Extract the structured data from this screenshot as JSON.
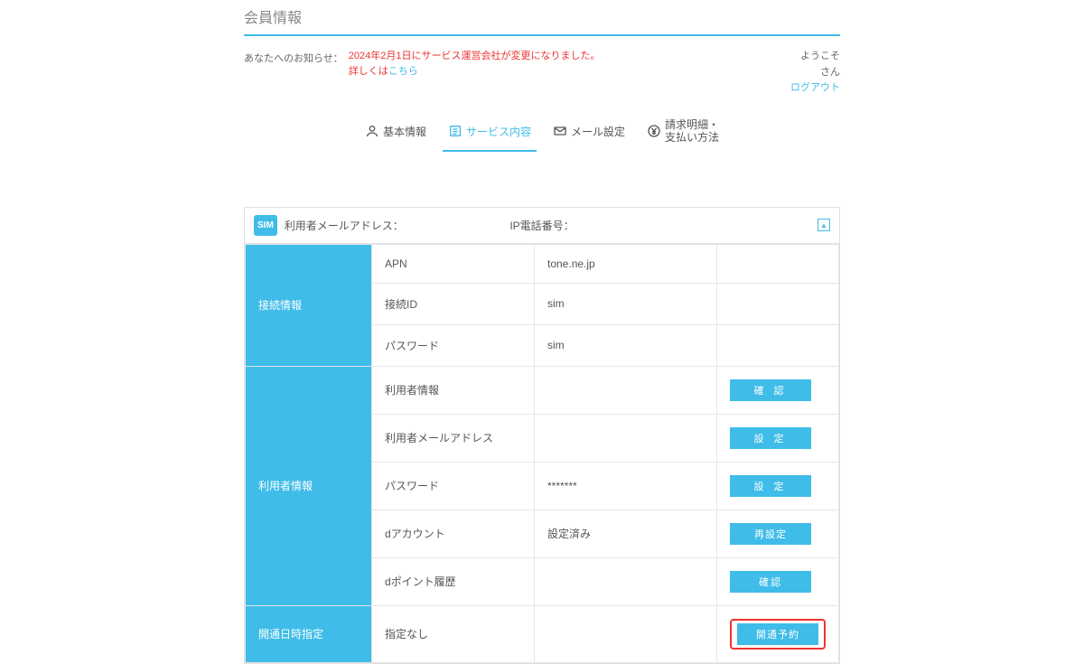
{
  "page": {
    "title": "会員情報"
  },
  "notice": {
    "label": "あなたへのお知らせ：",
    "line1": "2024年2月1日にサービス運営会社が変更になりました。",
    "line2_prefix": "詳しくは",
    "line2_link": "こちら"
  },
  "welcome": {
    "greeting": "ようこそ",
    "honorific": "さん",
    "logout": "ログアウト"
  },
  "tabs": {
    "basic": "基本情報",
    "service": "サービス内容",
    "mail": "メール設定",
    "billing_line1": "請求明細・",
    "billing_line2": "支払い方法"
  },
  "card": {
    "sim_badge": "SIM",
    "user_mail_label": "利用者メールアドレス：",
    "ip_phone_label": "IP電話番号：",
    "collapse_glyph": "▲"
  },
  "sections": {
    "connection": "接続情報",
    "userinfo": "利用者情報",
    "opendate": "開通日時指定"
  },
  "rows": {
    "apn": {
      "label": "APN",
      "value": "tone.ne.jp"
    },
    "connid": {
      "label": "接続ID",
      "value": "sim"
    },
    "connpw": {
      "label": "パスワード",
      "value": "sim"
    },
    "uinfo": {
      "label": "利用者情報",
      "value": "",
      "button": "確 認"
    },
    "umail": {
      "label": "利用者メールアドレス",
      "value": "",
      "button": "設 定"
    },
    "upw": {
      "label": "パスワード",
      "value": "*******",
      "button": "設 定"
    },
    "daccount": {
      "label": "dアカウント",
      "value": "設定済み",
      "button": "再設定"
    },
    "dpoint": {
      "label": "dポイント履歴",
      "value": "",
      "button": "確認"
    },
    "opendate": {
      "label": "指定なし",
      "value": "",
      "button": "開通予約"
    }
  }
}
